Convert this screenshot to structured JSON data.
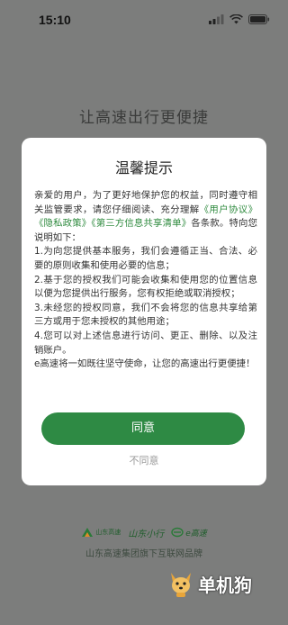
{
  "status_bar": {
    "time": "15:10"
  },
  "headline": "让高速出行更便捷",
  "dialog": {
    "title": "温馨提示",
    "body": {
      "intro_a": "亲爱的用户，为了更好地保护您的权益，同时遵守相关监管要求，请您仔细阅读、充分理解",
      "link_user_agreement": "《用户协议》",
      "link_privacy": "《隐私政策》",
      "link_third_party": "《第三方信息共享清单》",
      "intro_b": "各条款。特向您说明如下：",
      "item1": "1.为向您提供基本服务，我们会遵循正当、合法、必要的原则收集和使用必要的信息；",
      "item2": "2.基于您的授权我们可能会收集和使用您的位置信息以便为您提供出行服务，您有权拒绝或取消授权；",
      "item3": "3.未经您的授权同意，我们不会将您的信息共享给第三方或用于您未授权的其他用途；",
      "item4": "4.您可以对上述信息进行访问、更正、删除、以及注销账户。",
      "closing": "e高速将一如既往坚守使命，让您的高速出行更便捷！"
    },
    "agree_label": "同意",
    "disagree_label": "不同意"
  },
  "brand": {
    "logo1_text": "山东高速",
    "logo2_text": "山东小行",
    "logo3_text": "e高速",
    "caption": "山东高速集团旗下互联网品牌"
  },
  "watermark": {
    "text": "单机狗"
  },
  "colors": {
    "accent": "#2e8a44",
    "link": "#2e8a3e",
    "backdrop": "#7c7d7c"
  }
}
